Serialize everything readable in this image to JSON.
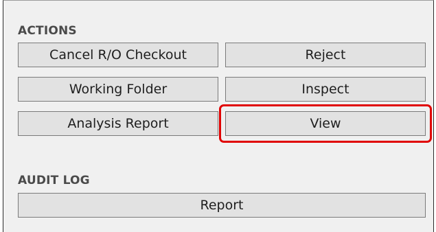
{
  "actions": {
    "header": "ACTIONS",
    "buttons": {
      "cancel_ro_checkout": "Cancel R/O Checkout",
      "reject": "Reject",
      "working_folder": "Working Folder",
      "inspect": "Inspect",
      "analysis_report": "Analysis Report",
      "view": "View"
    }
  },
  "audit_log": {
    "header": "AUDIT LOG",
    "buttons": {
      "report": "Report"
    }
  },
  "colors": {
    "highlight": "#e00000",
    "button_bg": "#e2e2e2",
    "panel_bg": "#f0f0f0"
  }
}
